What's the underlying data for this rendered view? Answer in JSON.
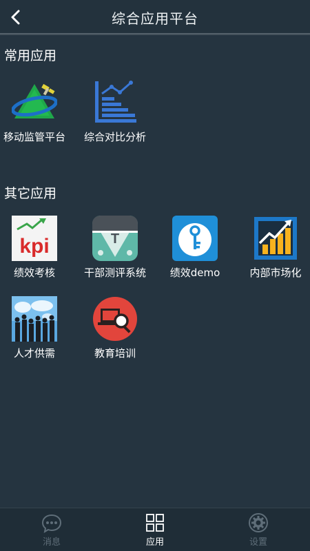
{
  "header": {
    "title": "综合应用平台"
  },
  "common": {
    "title": "常用应用",
    "apps": [
      {
        "label": "移动监管平台",
        "icon": "mobile-supervision-icon"
      },
      {
        "label": "综合对比分析",
        "icon": "comparison-analysis-icon"
      }
    ]
  },
  "other": {
    "title": "其它应用",
    "apps": [
      {
        "label": "绩效考核",
        "icon": "kpi-icon",
        "icon_text": "kpi"
      },
      {
        "label": "干部测评系统",
        "icon": "cadre-evaluation-icon",
        "icon_text": "T"
      },
      {
        "label": "绩效demo",
        "icon": "key-icon"
      },
      {
        "label": "内部市场化",
        "icon": "growth-chart-icon"
      },
      {
        "label": "人才供需",
        "icon": "talent-world-map-icon"
      },
      {
        "label": "教育培训",
        "icon": "training-search-icon"
      }
    ]
  },
  "tabbar": {
    "tabs": [
      {
        "label": "消息",
        "icon": "chat-bubble-icon",
        "active": false
      },
      {
        "label": "应用",
        "icon": "grid-icon",
        "active": true
      },
      {
        "label": "设置",
        "icon": "settings-gear-icon",
        "active": false
      }
    ]
  }
}
